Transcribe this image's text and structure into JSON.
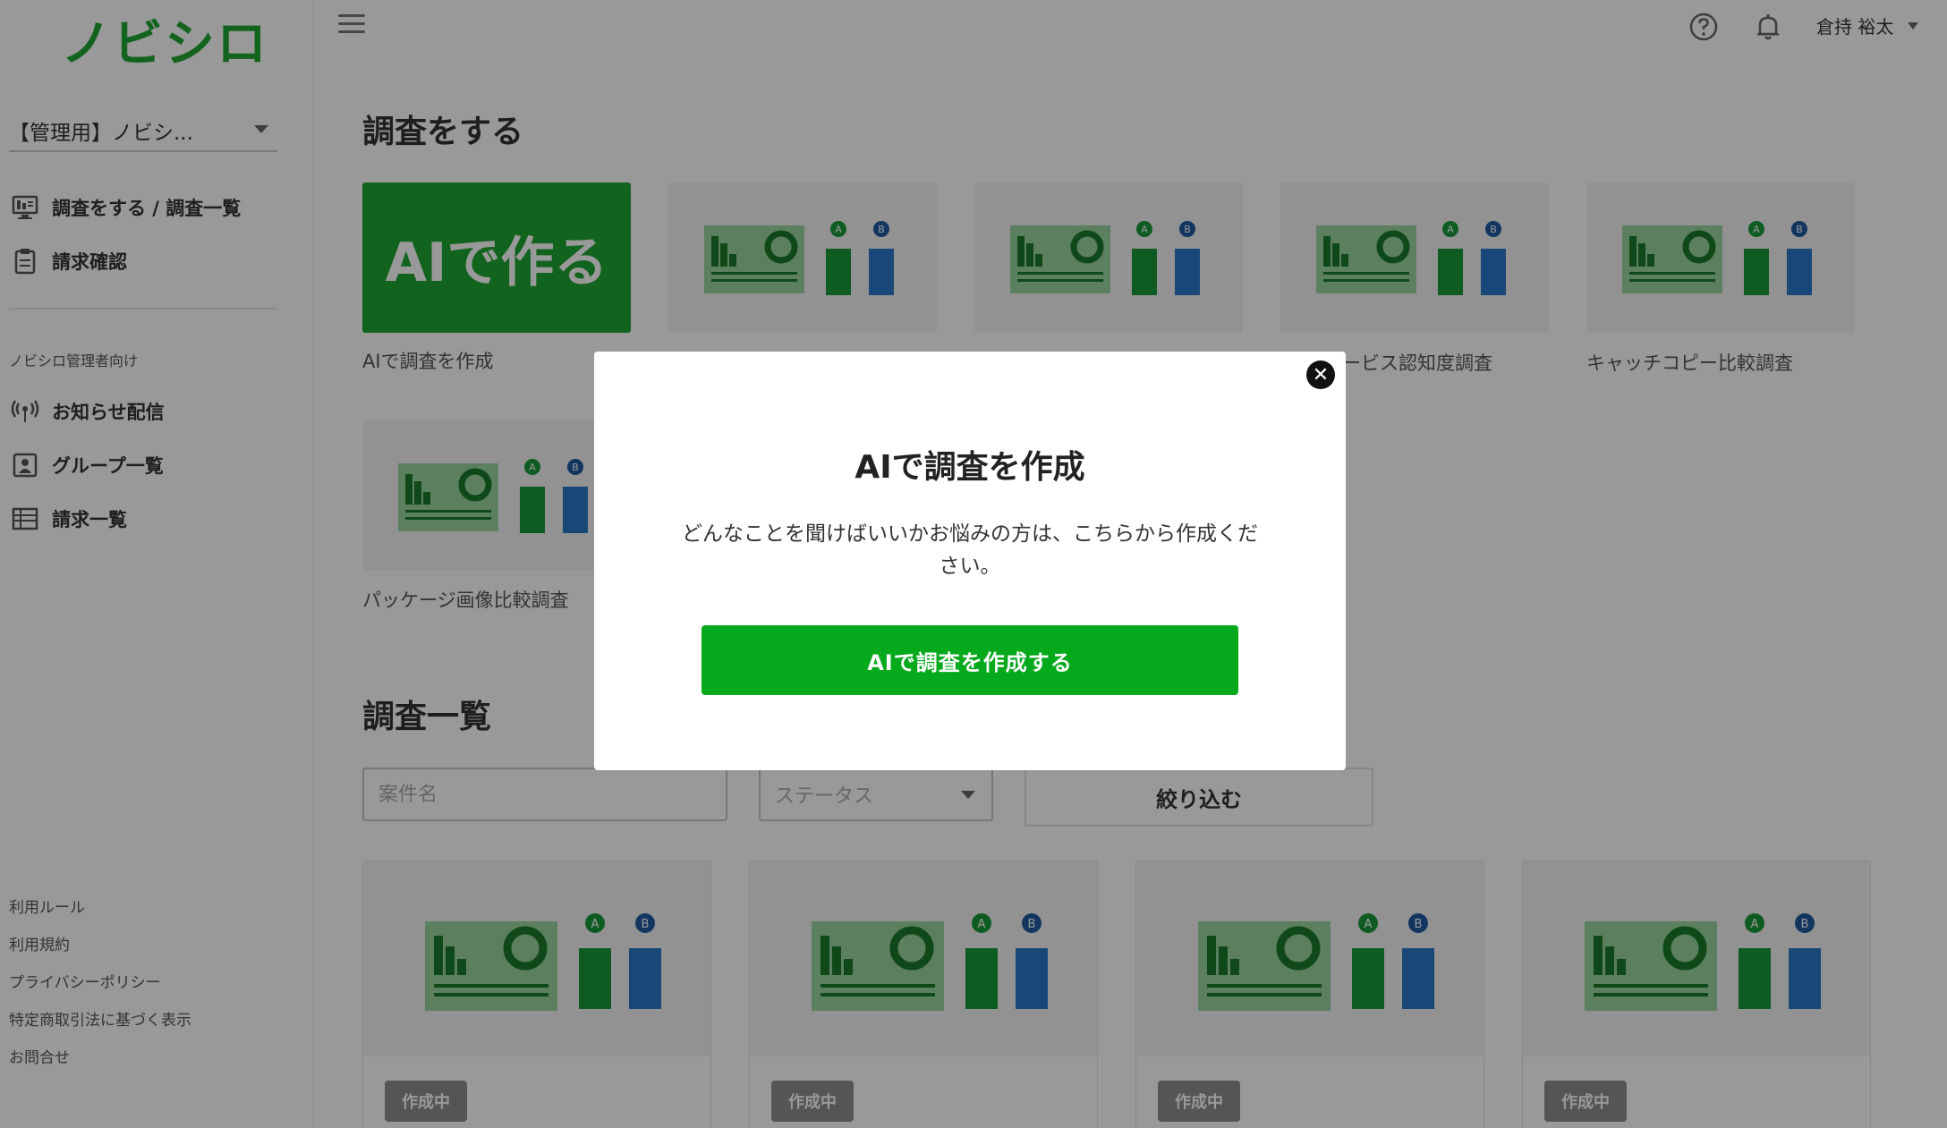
{
  "app": {
    "logo": "ノビシロ"
  },
  "sidebar": {
    "org_selected": "【管理用】ノビシ...",
    "items": [
      {
        "label": "調査をする / 調査一覧",
        "icon": "monitor-icon"
      },
      {
        "label": "請求確認",
        "icon": "clipboard-icon"
      }
    ],
    "admin_section_label": "ノビシロ管理者向け",
    "admin_items": [
      {
        "label": "お知らせ配信",
        "icon": "broadcast-icon"
      },
      {
        "label": "グループ一覧",
        "icon": "user-square-icon"
      },
      {
        "label": "請求一覧",
        "icon": "list-icon"
      }
    ],
    "footer_links": [
      "利用ルール",
      "利用規約",
      "プライバシーポリシー",
      "特定商取引法に基づく表示",
      "お問合せ"
    ]
  },
  "header": {
    "user_name": "倉持 裕太"
  },
  "main": {
    "create_section_title": "調査をする",
    "ai_card_text": "AIで作る",
    "templates": [
      {
        "label": "AIで調査を作成"
      },
      {
        "label": ""
      },
      {
        "label": ""
      },
      {
        "label": "ービス認知度調査"
      },
      {
        "label": "キャッチコピー比較調査"
      },
      {
        "label": "パッケージ画像比較調査"
      }
    ],
    "list_section_title": "調査一覧",
    "search_placeholder": "案件名",
    "status_placeholder": "ステータス",
    "filter_label": "絞り込む",
    "list_items": [
      {
        "status": "作成中"
      },
      {
        "status": "作成中"
      },
      {
        "status": "作成中"
      },
      {
        "status": "作成中"
      }
    ]
  },
  "modal": {
    "title": "AIで調査を作成",
    "description": "どんなことを聞けばいいかお悩みの方は、こちらから作成ください。",
    "button_label": "AIで調査を作成する",
    "close_icon": "close-icon"
  },
  "colors": {
    "brand_green": "#1fa532",
    "button_green": "#04a91c",
    "badge_gray": "#8e8e8e"
  }
}
